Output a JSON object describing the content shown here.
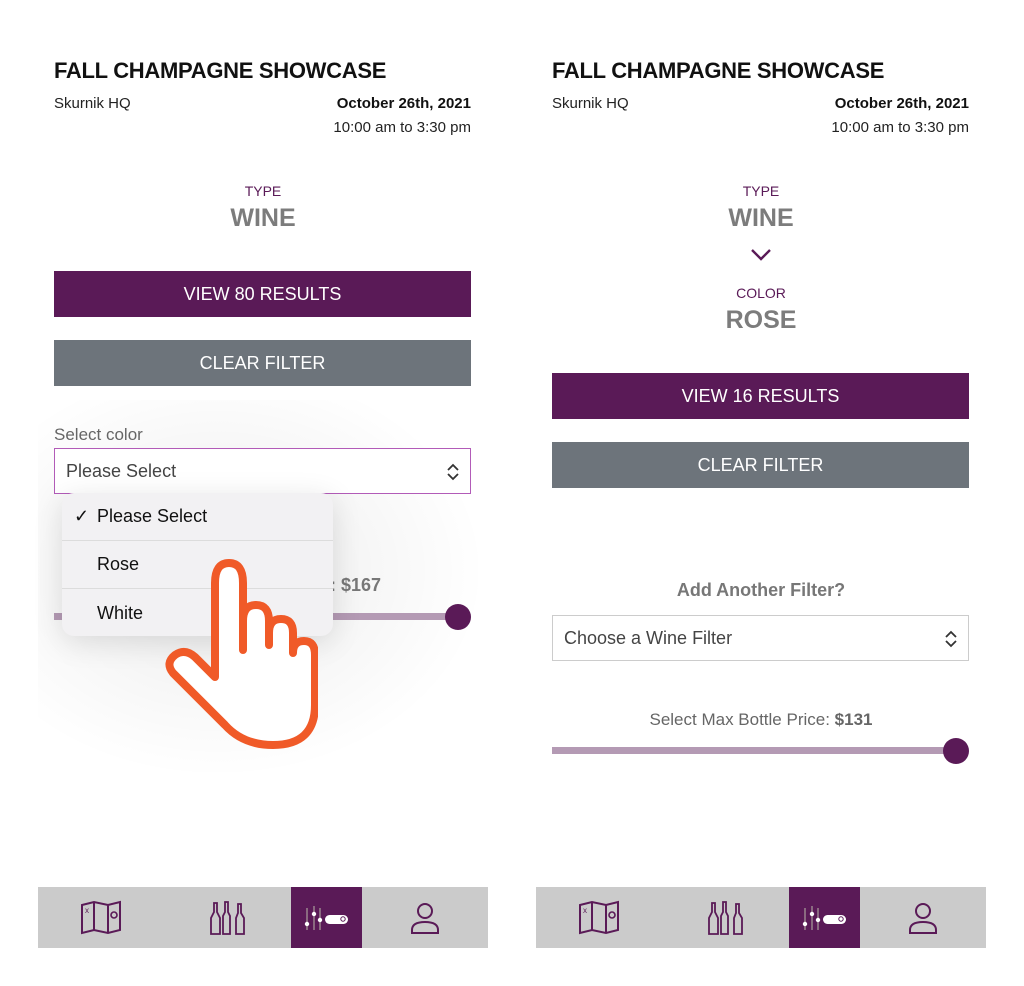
{
  "colors": {
    "brand": "#5a1a57",
    "clear": "#6d747b",
    "hand": "#f05a28"
  },
  "left": {
    "title": "FALL CHAMPAGNE SHOWCASE",
    "venue": "Skurnik HQ",
    "date": "October 26th, 2021",
    "time": "10:00 am to 3:30 pm",
    "type_label": "TYPE",
    "type_value": "WINE",
    "view_button": "VIEW 80 RESULTS",
    "clear_button": "CLEAR FILTER",
    "select_label": "Select color",
    "select_value": "Please Select",
    "menu_options": [
      {
        "label": "Please Select",
        "checked": true
      },
      {
        "label": "Rose"
      },
      {
        "label": "White"
      }
    ],
    "price_partial": ": $167",
    "slider_fraction": 1.0
  },
  "right": {
    "title": "FALL CHAMPAGNE SHOWCASE",
    "venue": "Skurnik HQ",
    "date": "October 26th, 2021",
    "time": "10:00 am to 3:30 pm",
    "type_label": "TYPE",
    "type_value": "WINE",
    "color_label": "COLOR",
    "color_value": "ROSE",
    "view_button": "VIEW 16 RESULTS",
    "clear_button": "CLEAR FILTER",
    "add_filter": "Add Another Filter?",
    "filter_select": "Choose a Wine Filter",
    "price_label": "Select Max Bottle Price: ",
    "price_value": "$131",
    "slider_fraction": 1.0
  },
  "nav": [
    {
      "icon": "map-icon"
    },
    {
      "icon": "bottles-icon"
    },
    {
      "icon": "filter-search-icon",
      "active": true
    },
    {
      "icon": "user-icon"
    }
  ]
}
